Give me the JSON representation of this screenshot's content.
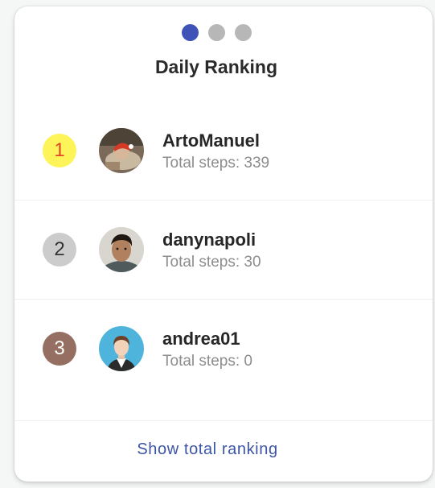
{
  "title": "Daily Ranking",
  "pager": {
    "count": 3,
    "active_index": 0
  },
  "ranking": [
    {
      "rank": "1",
      "name": "ArtoManuel",
      "steps": "Total steps: 339",
      "badge_color": "#fdf45a",
      "badge_text_color": "#e0452a",
      "avatar": "photo-red-cap"
    },
    {
      "rank": "2",
      "name": "danynapoli",
      "steps": "Total steps: 30",
      "badge_color": "#cccccc",
      "badge_text_color": "#333333",
      "avatar": "photo-man"
    },
    {
      "rank": "3",
      "name": "andrea01",
      "steps": "Total steps: 0",
      "badge_color": "#957062",
      "badge_text_color": "#ffffff",
      "avatar": "default-user-avatar"
    }
  ],
  "footer": {
    "link": "Show total ranking"
  },
  "colors": {
    "accent": "#3e52b8",
    "link": "#3c55a5"
  }
}
